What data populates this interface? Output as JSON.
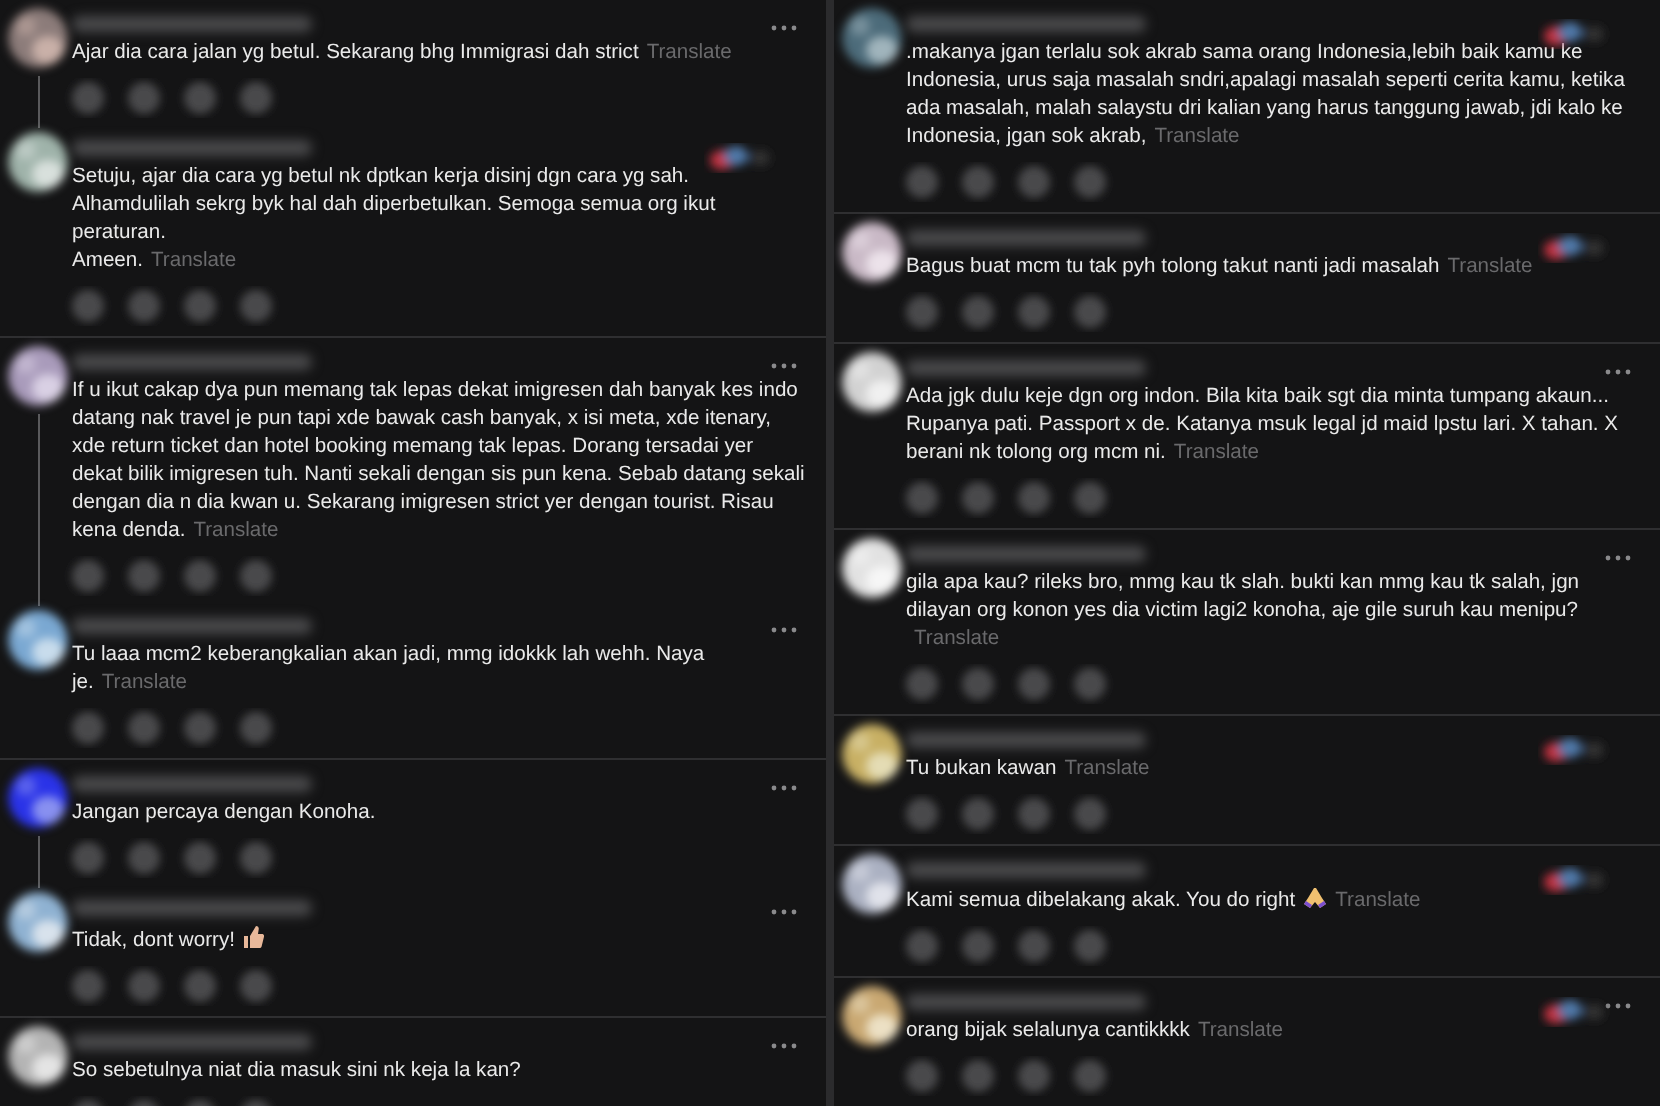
{
  "columns": [
    {
      "threads": [
        {
          "comments": [
            {
              "text": "Ajar dia cara jalan yg betul. Sekarang bhg Immigrasi dah strict",
              "translate": "Translate",
              "more_menu": true,
              "reaction": false
            },
            {
              "text": "Setuju, ajar dia cara yg betul nk dptkan kerja disinj dgn cara yg sah. Alhamdulilah sekrg byk hal dah diperbetulkan. Semoga semua org ikut peraturan.\nAmeen.",
              "translate": "Translate",
              "more_menu": false,
              "reaction": true
            }
          ]
        },
        {
          "comments": [
            {
              "text": "If u ikut cakap dya pun memang tak lepas dekat imigresen dah banyak kes indo datang nak travel je pun tapi xde bawak cash banyak, x isi meta, xde itenary, xde return ticket dan hotel booking memang tak lepas. Dorang tersadai yer dekat bilik imigresen tuh. Nanti sekali dengan sis pun kena. Sebab datang sekali dengan dia n dia kwan u. Sekarang imigresen strict yer dengan tourist. Risau kena denda.",
              "translate": "Translate",
              "more_menu": true,
              "reaction": false
            },
            {
              "text": "Tu laaa mcm2 keberangkalian akan jadi, mmg idokkk lah wehh. Naya je.",
              "translate": "Translate",
              "more_menu": true,
              "reaction": false
            }
          ]
        },
        {
          "comments": [
            {
              "text": "Jangan percaya dengan Konoha.",
              "more_menu": true,
              "reaction": false
            },
            {
              "text": "Tidak, dont worry!",
              "kind": "thumbs_up",
              "more_menu": true,
              "reaction": false
            }
          ]
        },
        {
          "comments": [
            {
              "text": "So sebetulnya niat dia masuk sini nk keja la kan?",
              "more_menu": true,
              "reaction": false
            }
          ]
        }
      ]
    },
    {
      "threads": [
        {
          "comments": [
            {
              "text": ".makanya jgan terlalu sok akrab sama orang Indonesia,lebih baik kamu ke Indonesia, urus saja masalah sndri,apalagi masalah seperti cerita kamu, ketika ada masalah, malah salaystu dri kalian yang harus tanggung jawab, jdi kalo ke Indonesia, jgan sok akrab,",
              "translate": "Translate",
              "more_menu": false,
              "reaction": true
            }
          ]
        },
        {
          "comments": [
            {
              "text": "Bagus buat mcm tu tak pyh tolong takut nanti jadi masalah",
              "translate": "Translate",
              "more_menu": false,
              "reaction": true
            }
          ]
        },
        {
          "comments": [
            {
              "text": "Ada jgk dulu keje dgn org indon. Bila kita baik sgt dia minta tumpang akaun... Rupanya pati. Passport x de. Katanya msuk legal jd maid lpstu lari. X tahan. X berani nk tolong org mcm ni.",
              "translate": "Translate",
              "more_menu": true,
              "reaction": false
            }
          ]
        },
        {
          "comments": [
            {
              "text": "gila apa kau? rileks bro, mmg kau tk slah. bukti kan mmg kau tk salah, jgn dilayan org konon yes dia victim lagi2 konoha, aje gile suruh kau menipu?",
              "translate": "Translate",
              "more_menu": true,
              "reaction": false
            }
          ]
        },
        {
          "comments": [
            {
              "text": "Tu bukan kawan",
              "translate": "Translate",
              "more_menu": false,
              "reaction": true
            }
          ]
        },
        {
          "comments": [
            {
              "text": "Kami semua dibelakang akak. You do right",
              "kind": "pray",
              "translate": "Translate",
              "more_menu": false,
              "reaction": true
            }
          ]
        },
        {
          "comments": [
            {
              "text": "orang bijak selalunya cantikkkk",
              "translate": "Translate",
              "more_menu": true,
              "reaction": true
            }
          ]
        }
      ]
    }
  ]
}
